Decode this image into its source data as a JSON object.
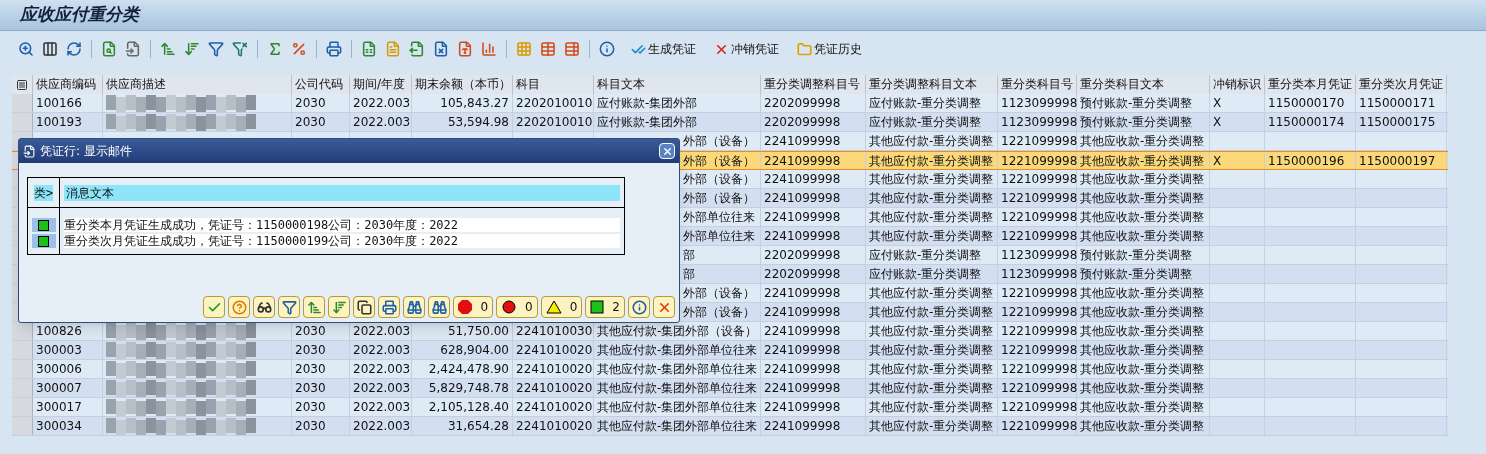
{
  "window": {
    "title": "应收应付重分类"
  },
  "toolbar_buttons": [
    {
      "kind": "post",
      "label": "生成凭证"
    },
    {
      "kind": "reverse",
      "label": "冲销凭证"
    },
    {
      "kind": "history",
      "label": "凭证历史"
    }
  ],
  "table": {
    "columns": [
      "供应商编码",
      "供应商描述",
      "公司代码",
      "期间/年度",
      "期末余额（本币）",
      "科目",
      "科目文本",
      "重分类调整科目号",
      "重分类调整科目文本",
      "重分类科目号",
      "重分类科目文本",
      "冲销标识",
      "重分类本月凭证",
      "重分类次月凭证"
    ],
    "rows": [
      {
        "vendor": "100166",
        "blurred": true,
        "company": "2030",
        "period": "2022.003",
        "balance": "105,843.27",
        "account": "2202010010",
        "account_text": "应付账款-集团外部",
        "adj_account": "2202099998",
        "adj_text": "应付账款-重分类调整",
        "reclass_account": "1123099998",
        "reclass_text": "预付账款-重分类调整",
        "reversal": "X",
        "doc_this": "1150000170",
        "doc_next": "1150000171",
        "selected": false
      },
      {
        "vendor": "100193",
        "blurred": true,
        "company": "2030",
        "period": "2022.003",
        "balance": "53,594.98",
        "account": "2202010010",
        "account_text": "应付账款-集团外部",
        "adj_account": "2202099998",
        "adj_text": "应付账款-重分类调整",
        "reclass_account": "1123099998",
        "reclass_text": "预付账款-重分类调整",
        "reversal": "X",
        "doc_this": "1150000174",
        "doc_next": "1150000175",
        "selected": false
      },
      {
        "account_text_partial": "外部（设备）",
        "adj_account": "2241099998",
        "adj_text": "其他应付款-重分类调整",
        "reclass_account": "1221099998",
        "reclass_text": "其他应收款-重分类调整",
        "selected": false
      },
      {
        "account_text_partial": "外部（设备）",
        "adj_account": "2241099998",
        "adj_text": "其他应付款-重分类调整",
        "reclass_account": "1221099998",
        "reclass_text": "其他应收款-重分类调整",
        "reversal": "X",
        "doc_this": "1150000196",
        "doc_next": "1150000197",
        "selected": true
      },
      {
        "account_text_partial": "外部（设备）",
        "adj_account": "2241099998",
        "adj_text": "其他应付款-重分类调整",
        "reclass_account": "1221099998",
        "reclass_text": "其他应收款-重分类调整",
        "selected": false
      },
      {
        "account_text_partial": "外部（设备）",
        "adj_account": "2241099998",
        "adj_text": "其他应付款-重分类调整",
        "reclass_account": "1221099998",
        "reclass_text": "其他应收款-重分类调整",
        "selected": false
      },
      {
        "account_text_partial": "外部单位往来",
        "adj_account": "2241099998",
        "adj_text": "其他应付款-重分类调整",
        "reclass_account": "1221099998",
        "reclass_text": "其他应收款-重分类调整",
        "selected": false
      },
      {
        "account_text_partial": "外部单位往来",
        "adj_account": "2241099998",
        "adj_text": "其他应付款-重分类调整",
        "reclass_account": "1221099998",
        "reclass_text": "其他应收款-重分类调整",
        "selected": false
      },
      {
        "account_text_partial": "部",
        "adj_account": "2202099998",
        "adj_text": "应付账款-重分类调整",
        "reclass_account": "1123099998",
        "reclass_text": "预付账款-重分类调整",
        "selected": false
      },
      {
        "account_text_partial": "部",
        "adj_account": "2202099998",
        "adj_text": "应付账款-重分类调整",
        "reclass_account": "1123099998",
        "reclass_text": "预付账款-重分类调整",
        "selected": false
      },
      {
        "account_text_partial": "外部（设备）",
        "adj_account": "2241099998",
        "adj_text": "其他应付款-重分类调整",
        "reclass_account": "1221099998",
        "reclass_text": "其他应收款-重分类调整",
        "selected": false
      },
      {
        "account_text_partial": "外部（设备）",
        "adj_account": "2241099998",
        "adj_text": "其他应付款-重分类调整",
        "reclass_account": "1221099998",
        "reclass_text": "其他应收款-重分类调整",
        "selected": false
      },
      {
        "vendor": "100826",
        "blurred": true,
        "company": "2030",
        "period": "2022.003",
        "balance": "51,750.00",
        "account": "2241010030",
        "account_text": "其他应付款-集团外部（设备）",
        "adj_account": "2241099998",
        "adj_text": "其他应付款-重分类调整",
        "reclass_account": "1221099998",
        "reclass_text": "其他应收款-重分类调整",
        "selected": false
      },
      {
        "vendor": "300003",
        "blurred": true,
        "company": "2030",
        "period": "2022.003",
        "balance": "628,904.00",
        "account": "2241010020",
        "account_text": "其他应付款-集团外部单位往来",
        "adj_account": "2241099998",
        "adj_text": "其他应付款-重分类调整",
        "reclass_account": "1221099998",
        "reclass_text": "其他应收款-重分类调整",
        "selected": false
      },
      {
        "vendor": "300006",
        "blurred": true,
        "company": "2030",
        "period": "2022.003",
        "balance": "2,424,478.90",
        "account": "2241010020",
        "account_text": "其他应付款-集团外部单位往来",
        "adj_account": "2241099998",
        "adj_text": "其他应付款-重分类调整",
        "reclass_account": "1221099998",
        "reclass_text": "其他应收款-重分类调整",
        "selected": false
      },
      {
        "vendor": "300007",
        "blurred": true,
        "company": "2030",
        "period": "2022.003",
        "balance": "5,829,748.78",
        "account": "2241010020",
        "account_text": "其他应付款-集团外部单位往来",
        "adj_account": "2241099998",
        "adj_text": "其他应付款-重分类调整",
        "reclass_account": "1221099998",
        "reclass_text": "其他应收款-重分类调整",
        "selected": false
      },
      {
        "vendor": "300017",
        "blurred": true,
        "company": "2030",
        "period": "2022.003",
        "balance": "2,105,128.40",
        "account": "2241010020",
        "account_text": "其他应付款-集团外部单位往来",
        "adj_account": "2241099998",
        "adj_text": "其他应付款-重分类调整",
        "reclass_account": "1221099998",
        "reclass_text": "其他应收款-重分类调整",
        "selected": false
      },
      {
        "vendor": "300034",
        "blurred": true,
        "company": "2030",
        "period": "2022.003",
        "balance": "31,654.28",
        "account": "2241010020",
        "account_text": "其他应付款-集团外部单位往来",
        "adj_account": "2241099998",
        "adj_text": "其他应付款-重分类调整",
        "reclass_account": "1221099998",
        "reclass_text": "其他应收款-重分类调整",
        "selected": false
      }
    ]
  },
  "dialog": {
    "title": "凭证行: 显示邮件",
    "header_type": "类>",
    "header_text": "消息文本",
    "messages": [
      {
        "kind": "success",
        "text": "重分类本月凭证生成成功，凭证号：1150000198公司：2030年度：2022"
      },
      {
        "kind": "success",
        "text": "重分类次月凭证生成成功，凭证号：1150000199公司：2030年度：2022"
      }
    ],
    "counters": [
      {
        "kind": "stop",
        "count": "0"
      },
      {
        "kind": "error",
        "count": "0"
      },
      {
        "kind": "warning",
        "count": "0"
      },
      {
        "kind": "success",
        "count": "2"
      }
    ]
  }
}
